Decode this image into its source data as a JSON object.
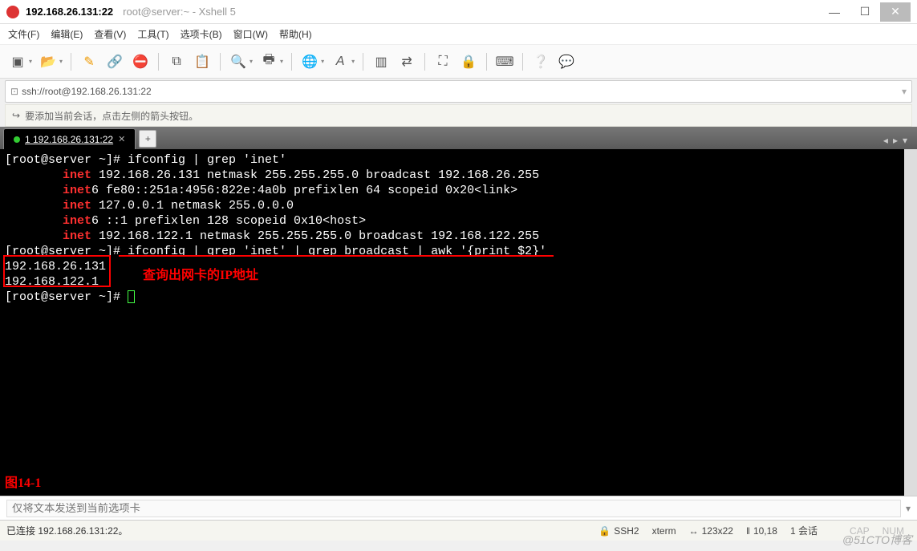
{
  "window": {
    "address": "192.168.26.131:22",
    "subtitle": "root@server:~ - Xshell 5"
  },
  "menu": {
    "file": "文件(F)",
    "edit": "编辑(E)",
    "view": "查看(V)",
    "tools": "工具(T)",
    "tabs": "选项卡(B)",
    "window": "窗口(W)",
    "help": "帮助(H)"
  },
  "addressbar": {
    "url": "ssh://root@192.168.26.131:22"
  },
  "infobar": {
    "text": "要添加当前会话，点击左侧的箭头按钮。"
  },
  "tab": {
    "label": "1 192.168.26.131:22"
  },
  "terminal": {
    "l1_prompt": "[root@server ~]# ",
    "l1_cmd": "ifconfig | grep 'inet'",
    "l2_a": "inet",
    "l2_b": " 192.168.26.131  netmask 255.255.255.0  broadcast 192.168.26.255",
    "l3_a": "inet",
    "l3_b": "6 fe80::251a:4956:822e:4a0b  prefixlen 64  scopeid 0x20<link>",
    "l4_a": "inet",
    "l4_b": " 127.0.0.1  netmask 255.0.0.0",
    "l5_a": "inet",
    "l5_b": "6 ::1  prefixlen 128  scopeid 0x10<host>",
    "l6_a": "inet",
    "l6_b": " 192.168.122.1  netmask 255.255.255.0  broadcast 192.168.122.255",
    "l7_prompt": "[root@server ~]# ",
    "l7_cmd": "ifconfig | grep 'inet' | grep broadcast | awk '{print $2}'",
    "l8": "192.168.26.131",
    "l9": "192.168.122.1",
    "l10_prompt": "[root@server ~]# "
  },
  "annotations": {
    "label": "查询出网卡的IP地址",
    "figure": "图14-1"
  },
  "sendbar": {
    "placeholder": "仅将文本发送到当前选项卡"
  },
  "status": {
    "left": "已连接 192.168.26.131:22。",
    "ssh": "SSH2",
    "term": "xterm",
    "size": "123x22",
    "pos": "10,18",
    "sess": "1 会话",
    "caps": "CAP",
    "num": "NUM"
  },
  "watermark": "@51CTO博客"
}
